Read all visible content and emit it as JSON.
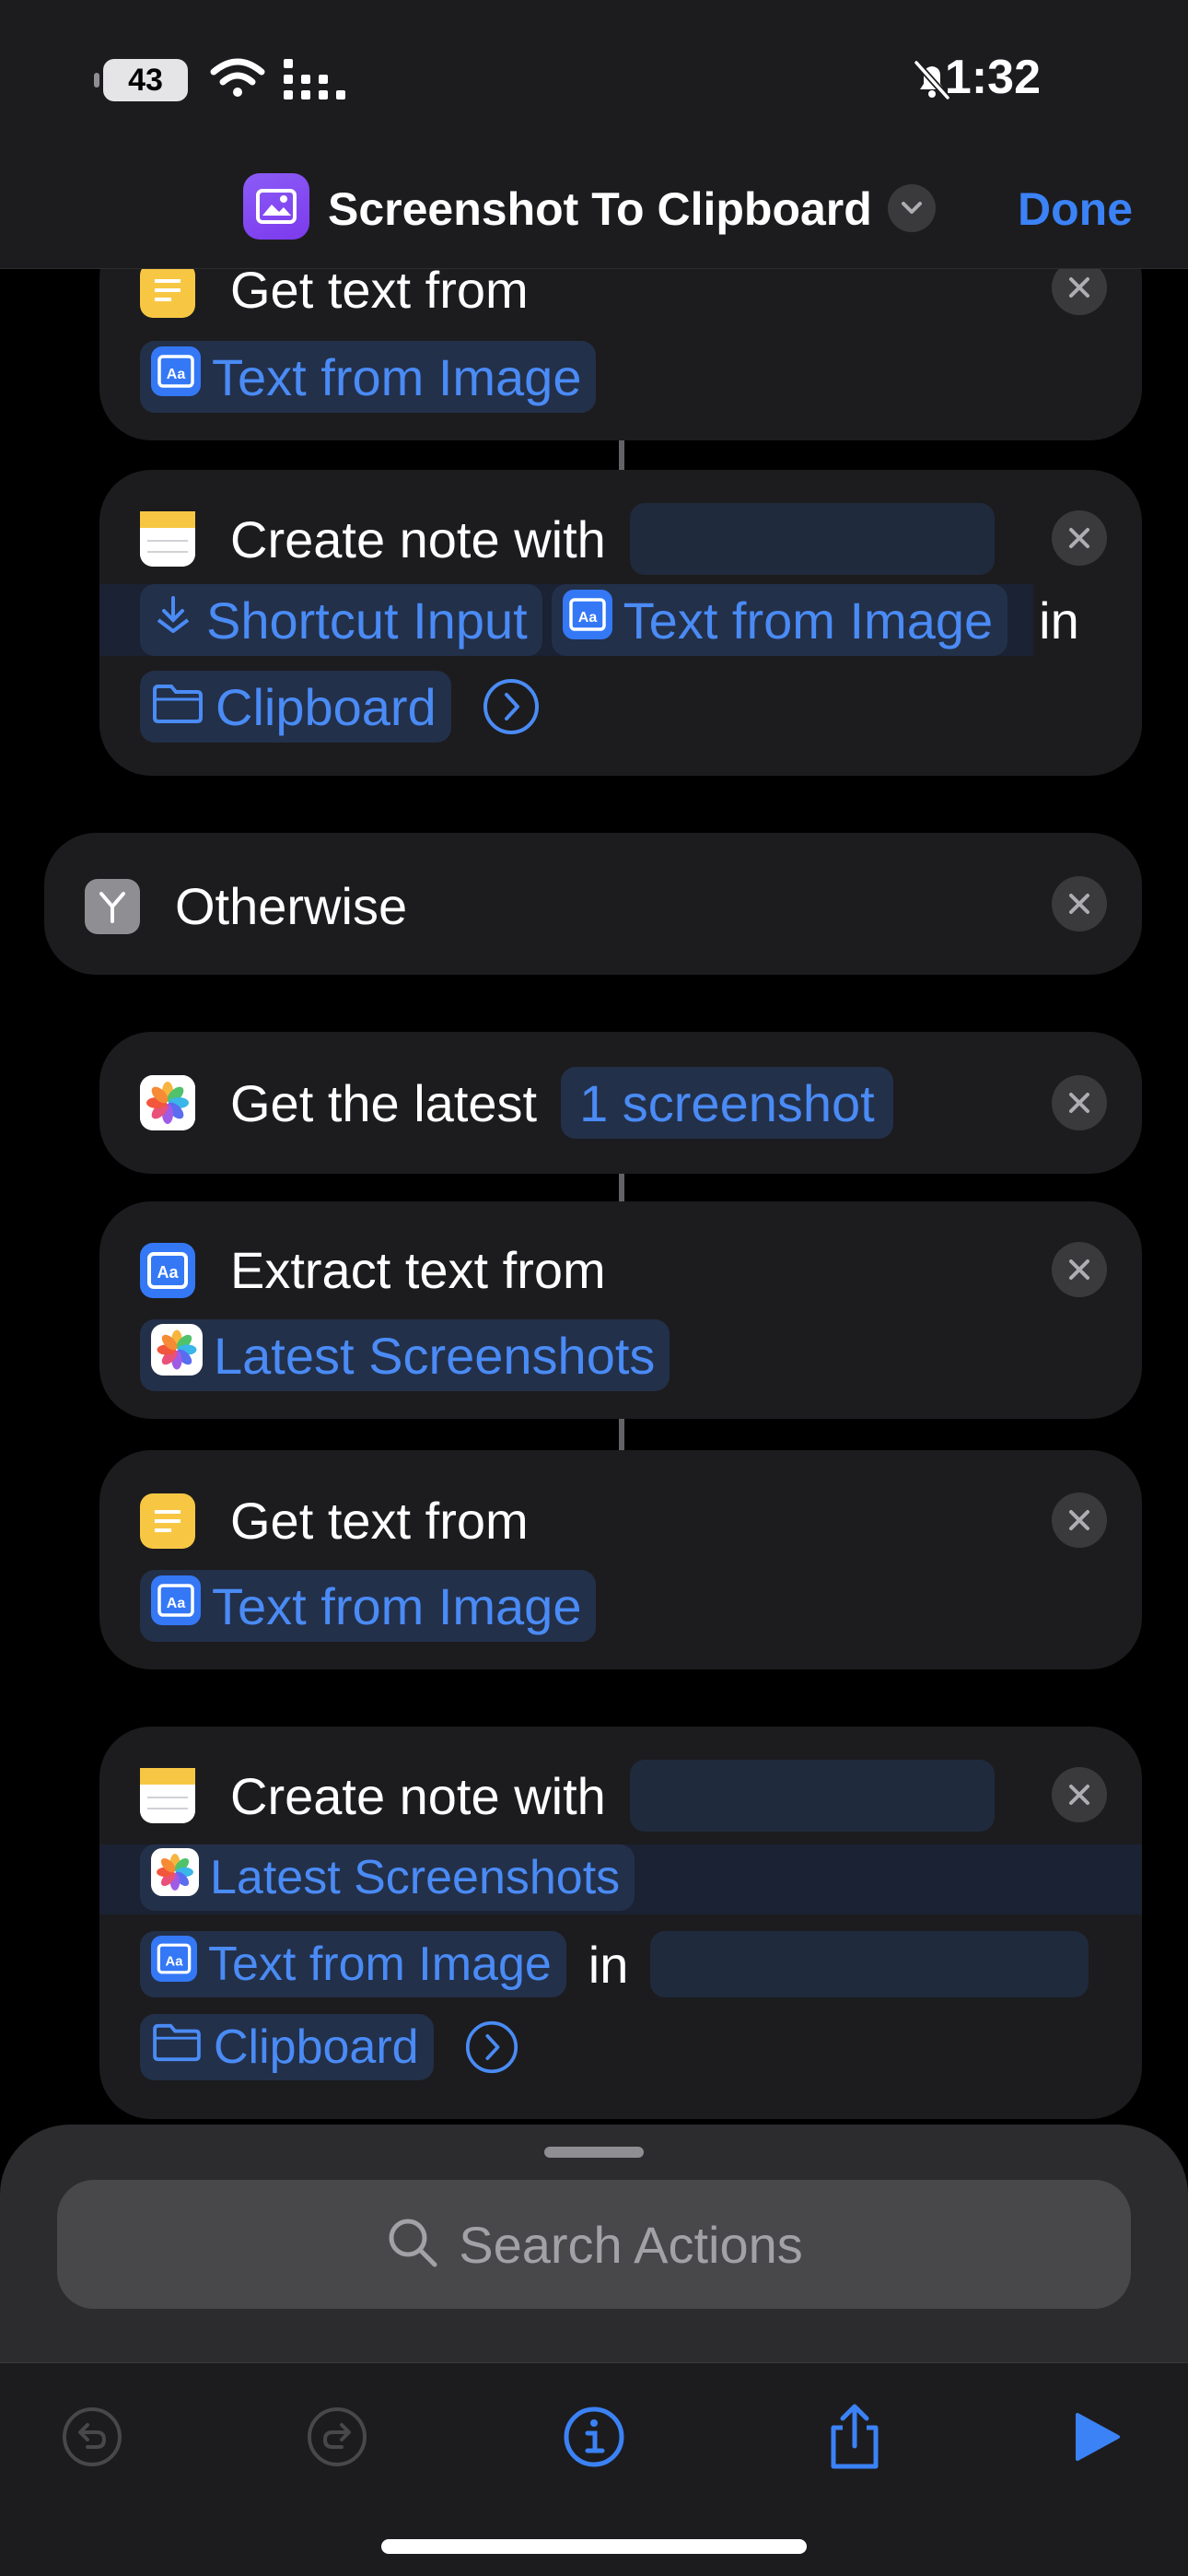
{
  "status_bar": {
    "battery": "43",
    "time": "1:32"
  },
  "nav": {
    "title": "Screenshot To Clipboard",
    "done_label": "Done"
  },
  "actions": {
    "get_text_1": {
      "label": "Get text from",
      "input": "Text from Image"
    },
    "create_note_1": {
      "label": "Create note with",
      "input1": "Shortcut Input",
      "input2": "Text from Image",
      "in_label": "in",
      "folder": "Clipboard"
    },
    "otherwise": {
      "label": "Otherwise"
    },
    "get_latest": {
      "label": "Get the latest",
      "value": "1 screenshot"
    },
    "extract_text": {
      "label": "Extract text from",
      "input": "Latest Screenshots"
    },
    "get_text_2": {
      "label": "Get text from",
      "input": "Text from Image"
    },
    "create_note_2": {
      "label": "Create note with",
      "input1": "Latest Screenshots",
      "input2": "Text from Image",
      "in_label": "in",
      "folder": "Clipboard"
    }
  },
  "search": {
    "placeholder": "Search Actions"
  },
  "icons": {
    "accent": "#3b82f6",
    "battery": "battery-icon",
    "wifi": "wifi-icon",
    "cellular": "cellular-icon",
    "silent": "bell-slash-icon",
    "undo": "undo-icon",
    "redo": "redo-icon",
    "info": "info-icon",
    "share": "share-icon",
    "play": "play-icon"
  }
}
